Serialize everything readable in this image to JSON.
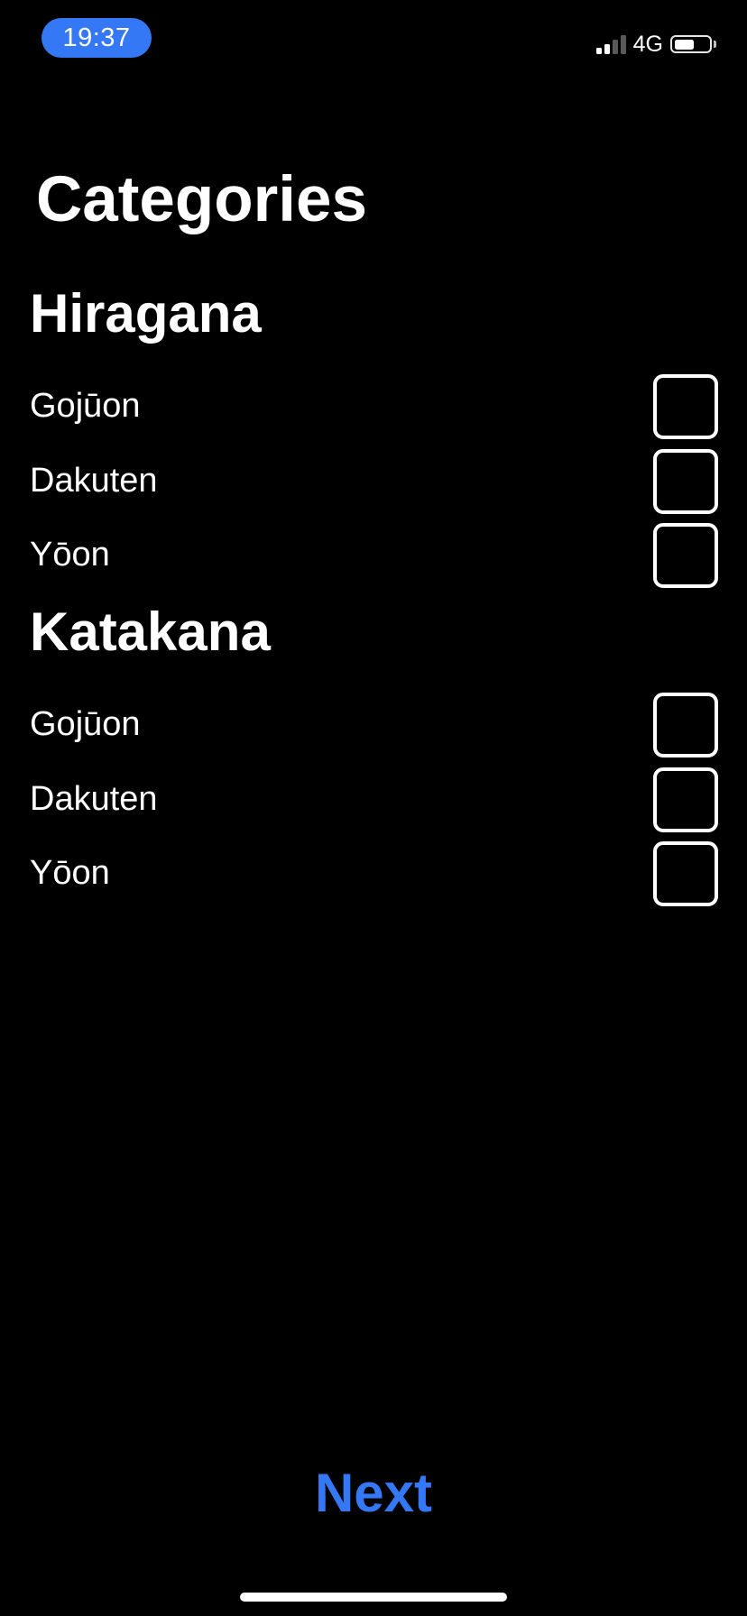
{
  "status_bar": {
    "time": "19:37",
    "network": "4G",
    "signal_bars_filled": 2,
    "signal_bars_total": 4,
    "battery_level": 0.6,
    "time_pill_color": "#3478f6"
  },
  "page": {
    "title": "Categories"
  },
  "sections": [
    {
      "header": "Hiragana",
      "items": [
        {
          "label": "Gojūon",
          "checked": false
        },
        {
          "label": "Dakuten",
          "checked": false
        },
        {
          "label": "Yōon",
          "checked": false
        }
      ]
    },
    {
      "header": "Katakana",
      "items": [
        {
          "label": "Gojūon",
          "checked": false
        },
        {
          "label": "Dakuten",
          "checked": false
        },
        {
          "label": "Yōon",
          "checked": false
        }
      ]
    }
  ],
  "footer": {
    "next_label": "Next",
    "accent_color": "#3478f6"
  }
}
